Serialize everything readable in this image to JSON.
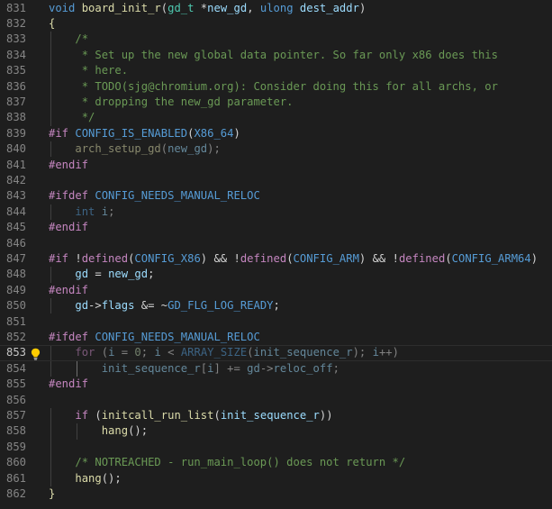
{
  "editor": {
    "theme_colors": {
      "background": "#1e1e1e",
      "line_number": "#858585",
      "keyword": "#569cd6",
      "control": "#c586c0",
      "function": "#dcdcaa",
      "type": "#4ec9b0",
      "variable": "#9cdcfe",
      "number": "#b5cea8",
      "comment": "#6a9955",
      "text": "#d4d4d4"
    },
    "current_line": "853",
    "gutter_icon": "lightbulb-icon",
    "lines": [
      {
        "no": "831",
        "tokens": [
          [
            "kw",
            "void"
          ],
          [
            "txt",
            " "
          ],
          [
            "fn",
            "board_init_r"
          ],
          [
            "txt",
            "("
          ],
          [
            "type",
            "gd_t"
          ],
          [
            "txt",
            " *"
          ],
          [
            "var",
            "new_gd"
          ],
          [
            "txt",
            ", "
          ],
          [
            "kw",
            "ulong"
          ],
          [
            "txt",
            " "
          ],
          [
            "var",
            "dest_addr"
          ],
          [
            "txt",
            ")"
          ]
        ]
      },
      {
        "no": "832",
        "tokens": [
          [
            "fn",
            "{"
          ]
        ]
      },
      {
        "no": "833",
        "tokens": [
          [
            "txt",
            "    "
          ],
          [
            "com",
            "/*"
          ]
        ]
      },
      {
        "no": "834",
        "tokens": [
          [
            "txt",
            "    "
          ],
          [
            "com",
            " * Set up the new global data pointer. So far only x86 does this"
          ]
        ]
      },
      {
        "no": "835",
        "tokens": [
          [
            "txt",
            "    "
          ],
          [
            "com",
            " * here."
          ]
        ]
      },
      {
        "no": "836",
        "tokens": [
          [
            "txt",
            "    "
          ],
          [
            "com",
            " * TODO(sjg@chromium.org): Consider doing this for all archs, or"
          ]
        ]
      },
      {
        "no": "837",
        "tokens": [
          [
            "txt",
            "    "
          ],
          [
            "com",
            " * dropping the new_gd parameter."
          ]
        ]
      },
      {
        "no": "838",
        "tokens": [
          [
            "txt",
            "    "
          ],
          [
            "com",
            " */"
          ]
        ]
      },
      {
        "no": "839",
        "tokens": [
          [
            "ctl",
            "#if"
          ],
          [
            "txt",
            " "
          ],
          [
            "kw",
            "CONFIG_IS_ENABLED"
          ],
          [
            "txt",
            "("
          ],
          [
            "kw",
            "X86_64"
          ],
          [
            "txt",
            ")"
          ]
        ]
      },
      {
        "no": "840",
        "tokens": [
          [
            "txt",
            "    "
          ],
          [
            "fn",
            "arch_setup_gd",
            "dim"
          ],
          [
            "txt",
            "(",
            "dim"
          ],
          [
            "var",
            "new_gd",
            "dim"
          ],
          [
            "txt",
            ");",
            "dim"
          ]
        ]
      },
      {
        "no": "841",
        "tokens": [
          [
            "ctl",
            "#endif"
          ]
        ]
      },
      {
        "no": "842",
        "tokens": []
      },
      {
        "no": "843",
        "tokens": [
          [
            "ctl",
            "#ifdef"
          ],
          [
            "txt",
            " "
          ],
          [
            "kw",
            "CONFIG_NEEDS_MANUAL_RELOC"
          ]
        ]
      },
      {
        "no": "844",
        "tokens": [
          [
            "txt",
            "    "
          ],
          [
            "kw",
            "int",
            "dim"
          ],
          [
            "txt",
            " ",
            "dim"
          ],
          [
            "var",
            "i",
            "dim"
          ],
          [
            "txt",
            ";",
            "dim"
          ]
        ]
      },
      {
        "no": "845",
        "tokens": [
          [
            "ctl",
            "#endif"
          ]
        ]
      },
      {
        "no": "846",
        "tokens": []
      },
      {
        "no": "847",
        "tokens": [
          [
            "ctl",
            "#if"
          ],
          [
            "txt",
            " !"
          ],
          [
            "ctl",
            "defined"
          ],
          [
            "txt",
            "("
          ],
          [
            "kw",
            "CONFIG_X86"
          ],
          [
            "txt",
            ") && !"
          ],
          [
            "ctl",
            "defined"
          ],
          [
            "txt",
            "("
          ],
          [
            "kw",
            "CONFIG_ARM"
          ],
          [
            "txt",
            ") && !"
          ],
          [
            "ctl",
            "defined"
          ],
          [
            "txt",
            "("
          ],
          [
            "kw",
            "CONFIG_ARM64"
          ],
          [
            "txt",
            ")"
          ]
        ]
      },
      {
        "no": "848",
        "tokens": [
          [
            "txt",
            "    "
          ],
          [
            "var",
            "gd"
          ],
          [
            "txt",
            " = "
          ],
          [
            "var",
            "new_gd"
          ],
          [
            "txt",
            ";"
          ]
        ]
      },
      {
        "no": "849",
        "tokens": [
          [
            "ctl",
            "#endif"
          ]
        ]
      },
      {
        "no": "850",
        "tokens": [
          [
            "txt",
            "    "
          ],
          [
            "var",
            "gd"
          ],
          [
            "txt",
            "->"
          ],
          [
            "var",
            "flags"
          ],
          [
            "txt",
            " &= ~"
          ],
          [
            "kw",
            "GD_FLG_LOG_READY"
          ],
          [
            "txt",
            ";"
          ]
        ]
      },
      {
        "no": "851",
        "tokens": []
      },
      {
        "no": "852",
        "tokens": [
          [
            "ctl",
            "#ifdef"
          ],
          [
            "txt",
            " "
          ],
          [
            "kw",
            "CONFIG_NEEDS_MANUAL_RELOC"
          ]
        ]
      },
      {
        "no": "853",
        "tokens": [
          [
            "txt",
            "    "
          ],
          [
            "ctl",
            "for",
            "dim"
          ],
          [
            "txt",
            " (",
            "dim"
          ],
          [
            "var",
            "i",
            "dim"
          ],
          [
            "txt",
            " = ",
            "dim"
          ],
          [
            "num",
            "0",
            "dim"
          ],
          [
            "txt",
            "; ",
            "dim"
          ],
          [
            "var",
            "i",
            "dim"
          ],
          [
            "txt",
            " < ",
            "dim"
          ],
          [
            "kw",
            "ARRAY_SIZE",
            "dim"
          ],
          [
            "txt",
            "(",
            "dim"
          ],
          [
            "var",
            "init_sequence_r",
            "dim"
          ],
          [
            "txt",
            "); ",
            "dim"
          ],
          [
            "var",
            "i",
            "dim"
          ],
          [
            "txt",
            "++)",
            "dim"
          ]
        ]
      },
      {
        "no": "854",
        "tokens": [
          [
            "txt",
            "        "
          ],
          [
            "var",
            "init_sequence_r",
            "dim"
          ],
          [
            "txt",
            "[",
            "dim"
          ],
          [
            "var",
            "i",
            "dim"
          ],
          [
            "txt",
            "] += ",
            "dim"
          ],
          [
            "var",
            "gd",
            "dim"
          ],
          [
            "txt",
            "->",
            "dim"
          ],
          [
            "var",
            "reloc_off",
            "dim"
          ],
          [
            "txt",
            ";",
            "dim"
          ]
        ]
      },
      {
        "no": "855",
        "tokens": [
          [
            "ctl",
            "#endif"
          ]
        ]
      },
      {
        "no": "856",
        "tokens": []
      },
      {
        "no": "857",
        "tokens": [
          [
            "txt",
            "    "
          ],
          [
            "ctl",
            "if"
          ],
          [
            "txt",
            " ("
          ],
          [
            "fn",
            "initcall_run_list"
          ],
          [
            "txt",
            "("
          ],
          [
            "var",
            "init_sequence_r"
          ],
          [
            "txt",
            "))"
          ]
        ]
      },
      {
        "no": "858",
        "tokens": [
          [
            "txt",
            "        "
          ],
          [
            "fn",
            "hang"
          ],
          [
            "txt",
            "();"
          ]
        ]
      },
      {
        "no": "859",
        "tokens": []
      },
      {
        "no": "860",
        "tokens": [
          [
            "txt",
            "    "
          ],
          [
            "com",
            "/* NOTREACHED - run_main_loop() does not return */"
          ]
        ]
      },
      {
        "no": "861",
        "tokens": [
          [
            "txt",
            "    "
          ],
          [
            "fn",
            "hang"
          ],
          [
            "txt",
            "();"
          ]
        ]
      },
      {
        "no": "862",
        "tokens": [
          [
            "fn",
            "}"
          ]
        ]
      }
    ]
  }
}
